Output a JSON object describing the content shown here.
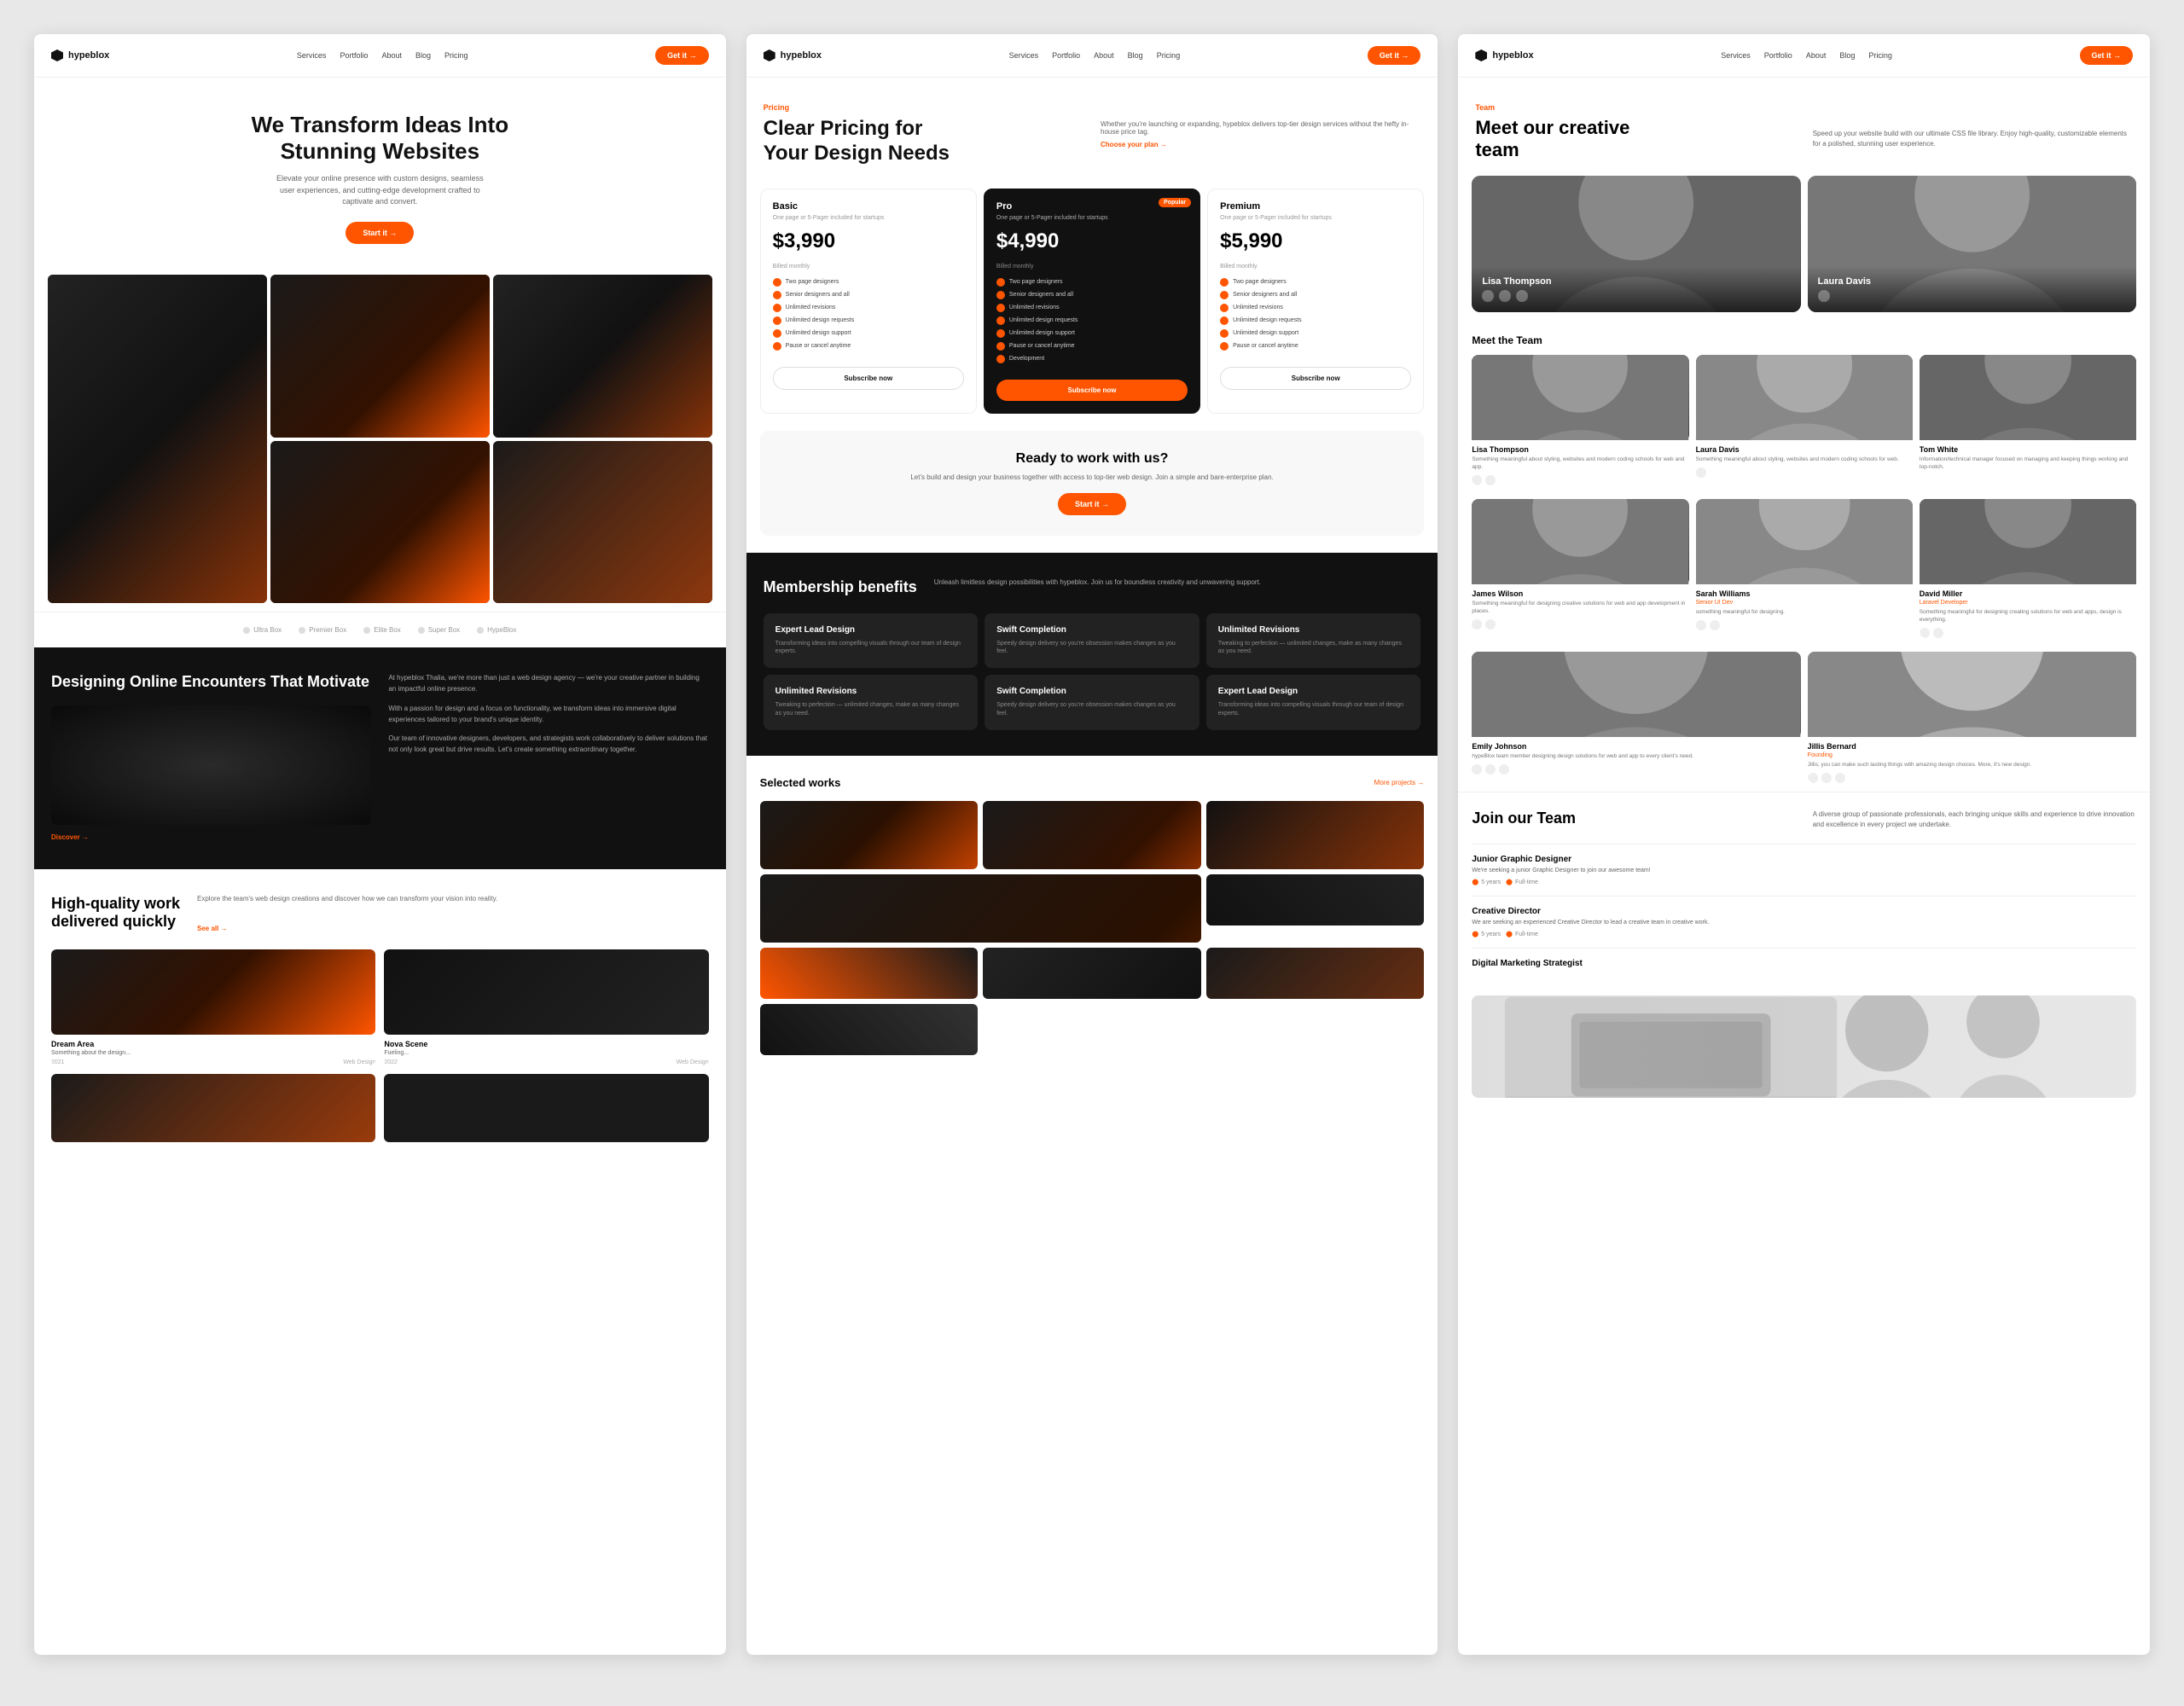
{
  "brand": {
    "name": "hypeblox",
    "logo_alt": "Hypeblox Logo"
  },
  "nav": {
    "links": [
      "Services",
      "Portfolio",
      "About",
      "Blog",
      "Pricing"
    ],
    "cta": "Get it →"
  },
  "page1": {
    "hero": {
      "title_line1": "We Transform Ideas Into",
      "title_line2": "Stunning Websites",
      "description": "Elevate your online presence with custom designs, seamless user experiences, and cutting-edge development crafted to captivate and convert.",
      "cta_label": "Start it →"
    },
    "brand_bar": {
      "items": [
        "Ultra Box",
        "Premier Box",
        "Elite Box",
        "Super Box",
        "HypeBlox"
      ]
    },
    "dark_section": {
      "title": "Designing Online Encounters That Motivate",
      "paragraphs": [
        "At hypeblox Thalia, we're more than just a web design agency — we're your creative partner in building an impactful online presence.",
        "With a passion for design and a focus on functionality, we transform ideas into immersive digital experiences tailored to your brand's unique identity.",
        "Our team of innovative designers, developers, and strategists work collaboratively to deliver solutions that not only look great but drive results. Let's create something extraordinary together."
      ],
      "cta": "Discover →"
    },
    "work_section": {
      "title_line1": "High-quality work",
      "title_line2": "delivered quickly",
      "description": "Explore the team's web design creations and discover how we can transform your vision into reality.",
      "cta": "See all →",
      "cards": [
        {
          "title": "Dream Area",
          "subtitle": "Something about the design...",
          "date": "2021",
          "category": "Web Design"
        },
        {
          "title": "Nova Scene",
          "subtitle": "Fueling...",
          "date": "2022",
          "category": "Web Design"
        }
      ]
    }
  },
  "page2": {
    "pricing": {
      "label": "Pricing",
      "title_line1": "Clear Pricing for",
      "title_line2": "Your Design Needs",
      "subtitle_right": "Whether you're launching or expanding, hypeblox delivers top-tier design services without the hefty in-house price tag.",
      "choose_plan": "Choose your plan →",
      "plans": [
        {
          "name": "Basic",
          "description": "One page or 5-Pager included for startups",
          "price": "$3,990",
          "billing": "Billed monthly",
          "featured": false,
          "features": [
            "Two page designers",
            "Senior designers and all",
            "Unlimited revisions",
            "Unlimited design requests",
            "Unlimited design support",
            "Pause or cancel anytime"
          ]
        },
        {
          "name": "Pro",
          "description": "One page or 5-Pager included for startups",
          "price": "$4,990",
          "billing": "Billed monthly",
          "featured": true,
          "badge": "Popular",
          "features": [
            "Two page designers",
            "Senior designers and all",
            "Unlimited revisions",
            "Unlimited design requests",
            "Unlimited design support",
            "Pause or cancel anytime",
            "Development"
          ]
        },
        {
          "name": "Premium",
          "description": "One page or 5-Pager included for startups",
          "price": "$5,990",
          "billing": "Billed monthly",
          "featured": false,
          "features": [
            "Two page designers",
            "Senior designers and all",
            "Unlimited revisions",
            "Unlimited design requests",
            "Unlimited design support",
            "Pause or cancel anytime"
          ]
        }
      ],
      "plan_cta": "Subscribe now"
    },
    "cta_banner": {
      "title": "Ready to work with us?",
      "description": "Let's build and design your business together with access to top-tier web design. Join a simple and bare-enterprise plan.",
      "cta": "Start it →"
    },
    "benefits": {
      "title": "Membership benefits",
      "subtitle": "Unleash limitless design possibilities with hypeblox. Join us for boundless creativity and unwavering support.",
      "items": [
        {
          "title": "Expert Lead Design",
          "desc": "Transforming ideas into compelling visuals through our team of design experts."
        },
        {
          "title": "Swift Completion",
          "desc": "Speedy design delivery so you're obsession makes changes as you feel."
        },
        {
          "title": "Unlimited Revisions",
          "desc": "Tweaking to perfection — unlimited changes, make as many changes as you need."
        },
        {
          "title": "Unlimited Revisions",
          "desc": "Tweaking to perfection — unlimited changes, make as many changes as you need."
        },
        {
          "title": "Swift Completion",
          "desc": "Speedy design delivery so you're obsession makes changes as you feel."
        },
        {
          "title": "Expert Lead Design",
          "desc": "Transforming ideas into compelling visuals through our team of design experts."
        }
      ]
    },
    "selected_works": {
      "title": "Selected works",
      "link": "More projects →"
    }
  },
  "page3": {
    "team": {
      "label": "Team",
      "title_line1": "Meet our creative",
      "title_line2": "team",
      "description": "Speed up your website build with our ultimate CSS file library. Enjoy high-quality, customizable elements for a polished, stunning user experience."
    },
    "featured_members": [
      {
        "name": "Lisa Thompson",
        "has_social": true
      },
      {
        "name": "Laura Davis",
        "has_social": true
      }
    ],
    "team_section_title": "Meet the Team",
    "team_members": [
      {
        "name": "Lisa Thompson",
        "role": "",
        "desc": "Something meaningful about styling, websites and modern coding schools for web and app.",
        "photo_class": "james"
      },
      {
        "name": "Laura Davis",
        "role": "",
        "desc": "Something meaningful about styling, websites and modern coding schools for web.",
        "photo_class": "sarah"
      },
      {
        "name": "Tom White",
        "role": "",
        "desc": "Information/technical manager focused on managing and keeping things working and top-notch.",
        "photo_class": "david"
      },
      {
        "name": "James Wilson",
        "role": "",
        "desc": "Something meaningful for designing creative solutions for web and app development in places.",
        "photo_class": "james"
      },
      {
        "name": "Sarah Williams",
        "role": "Senior UI Dev",
        "desc": "something meaningful for designing.",
        "photo_class": "sarah"
      },
      {
        "name": "David Miller",
        "role": "Laravel Developer",
        "desc": "Something meaningful for designing creating solutions for web and apps, design is everything.",
        "photo_class": "david"
      },
      {
        "name": "Emily Johnson",
        "role": "",
        "desc": "hypeBlox team member designing design solutions for web and app to every client's need.",
        "photo_class": "emily"
      },
      {
        "name": "Jillis Bernard",
        "role": "Founding",
        "desc": "Jillis, you can make such lasting things with amazing design choices. More, it's new design.",
        "photo_class": "jillis"
      }
    ],
    "join": {
      "title": "Join our Team",
      "description": "A diverse group of passionate professionals, each bringing unique skills and experience to drive innovation and excellence in every project we undertake.",
      "positions": [
        {
          "title": "Junior Graphic Designer",
          "desc": "We're seeking a junior Graphic Designer to join our awesome team!",
          "tags": [
            "5 years",
            "Full-time"
          ]
        },
        {
          "title": "Creative Director",
          "desc": "We are seeking an experienced Creative Director to lead a creative team in creative work.",
          "tags": [
            "5 years",
            "Full-time"
          ]
        },
        {
          "title": "Digital Marketing Strategist",
          "desc": "",
          "tags": []
        }
      ]
    }
  }
}
